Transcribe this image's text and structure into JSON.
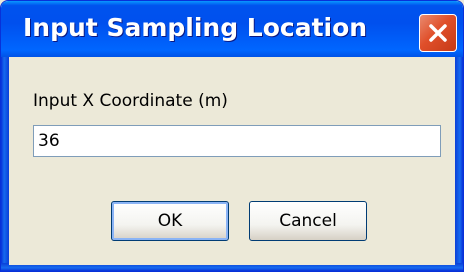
{
  "window": {
    "title": "Input Sampling Location"
  },
  "prompt": {
    "label": "Input X Coordinate (m)"
  },
  "input": {
    "value": "36"
  },
  "buttons": {
    "ok_label": "OK",
    "cancel_label": "Cancel"
  },
  "icons": {
    "close": "close-icon"
  },
  "colors": {
    "titlebar": "#0053ee",
    "close_button": "#e04f2a",
    "dialog_background": "#ece9d8"
  }
}
